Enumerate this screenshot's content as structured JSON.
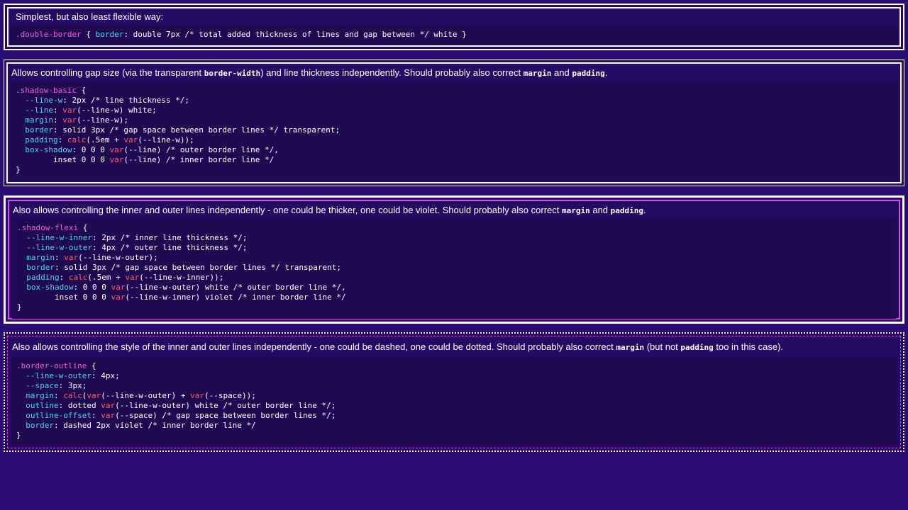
{
  "cards": [
    {
      "description": "Simplest, but also least flexible way:",
      "code": [
        [
          [
            "sel",
            ".double-border"
          ],
          [
            "punc",
            " { "
          ],
          [
            "prop",
            "border"
          ],
          [
            "punc",
            ": double 7px /* total added thickness of lines and gap between */ white }"
          ]
        ]
      ]
    },
    {
      "description_parts": [
        [
          "text",
          "Allows controlling gap size (via the transparent "
        ],
        [
          "code",
          "border-width"
        ],
        [
          "text",
          ") and line thickness independently. Should probably also correct "
        ],
        [
          "code",
          "margin"
        ],
        [
          "text",
          " and "
        ],
        [
          "code",
          "padding"
        ],
        [
          "text",
          "."
        ]
      ],
      "code": [
        [
          [
            "sel",
            ".shadow-basic"
          ],
          [
            "punc",
            " {"
          ]
        ],
        [
          [
            "punc",
            "  "
          ],
          [
            "prop",
            "--line-w"
          ],
          [
            "punc",
            ": 2px /* line thickness */;"
          ]
        ],
        [
          [
            "punc",
            "  "
          ],
          [
            "prop",
            "--line"
          ],
          [
            "punc",
            ": "
          ],
          [
            "fn",
            "var"
          ],
          [
            "punc",
            "(--line-w) white;"
          ]
        ],
        [
          [
            "punc",
            "  "
          ],
          [
            "prop",
            "margin"
          ],
          [
            "punc",
            ": "
          ],
          [
            "fn",
            "var"
          ],
          [
            "punc",
            "(--line-w);"
          ]
        ],
        [
          [
            "punc",
            "  "
          ],
          [
            "prop",
            "border"
          ],
          [
            "punc",
            ": solid 3px /* gap space between border lines */ transparent;"
          ]
        ],
        [
          [
            "punc",
            "  "
          ],
          [
            "prop",
            "padding"
          ],
          [
            "punc",
            ": "
          ],
          [
            "fn",
            "calc"
          ],
          [
            "punc",
            "(.5em + "
          ],
          [
            "fn",
            "var"
          ],
          [
            "punc",
            "(--line-w));"
          ]
        ],
        [
          [
            "punc",
            "  "
          ],
          [
            "prop",
            "box-shadow"
          ],
          [
            "punc",
            ": 0 0 0 "
          ],
          [
            "fn",
            "var"
          ],
          [
            "punc",
            "(--line) /* outer border line */,"
          ]
        ],
        [
          [
            "punc",
            "        inset 0 0 0 "
          ],
          [
            "fn",
            "var"
          ],
          [
            "punc",
            "(--line) /* inner border line */"
          ]
        ],
        [
          [
            "punc",
            "}"
          ]
        ]
      ]
    },
    {
      "description_parts": [
        [
          "text",
          "Also allows controlling the inner and outer lines independently - one could be thicker, one could be violet. Should probably also correct "
        ],
        [
          "code",
          "margin"
        ],
        [
          "text",
          " and "
        ],
        [
          "code",
          "padding"
        ],
        [
          "text",
          "."
        ]
      ],
      "code": [
        [
          [
            "sel",
            ".shadow-flexi"
          ],
          [
            "punc",
            " {"
          ]
        ],
        [
          [
            "punc",
            "  "
          ],
          [
            "prop",
            "--line-w-inner"
          ],
          [
            "punc",
            ": 2px /* inner line thickness */;"
          ]
        ],
        [
          [
            "punc",
            "  "
          ],
          [
            "prop",
            "--line-w-outer"
          ],
          [
            "punc",
            ": 4px /* outer line thickness */;"
          ]
        ],
        [
          [
            "punc",
            "  "
          ],
          [
            "prop",
            "margin"
          ],
          [
            "punc",
            ": "
          ],
          [
            "fn",
            "var"
          ],
          [
            "punc",
            "(--line-w-outer);"
          ]
        ],
        [
          [
            "punc",
            "  "
          ],
          [
            "prop",
            "border"
          ],
          [
            "punc",
            ": solid 3px /* gap space between border lines */ transparent;"
          ]
        ],
        [
          [
            "punc",
            "  "
          ],
          [
            "prop",
            "padding"
          ],
          [
            "punc",
            ": "
          ],
          [
            "fn",
            "calc"
          ],
          [
            "punc",
            "(.5em + "
          ],
          [
            "fn",
            "var"
          ],
          [
            "punc",
            "(--line-w-inner));"
          ]
        ],
        [
          [
            "punc",
            "  "
          ],
          [
            "prop",
            "box-shadow"
          ],
          [
            "punc",
            ": 0 0 0 "
          ],
          [
            "fn",
            "var"
          ],
          [
            "punc",
            "(--line-w-outer) white /* outer border line */,"
          ]
        ],
        [
          [
            "punc",
            "        inset 0 0 0 "
          ],
          [
            "fn",
            "var"
          ],
          [
            "punc",
            "(--line-w-inner) violet /* inner border line */"
          ]
        ],
        [
          [
            "punc",
            "}"
          ]
        ]
      ]
    },
    {
      "description_parts": [
        [
          "text",
          "Also allows controlling the style of the inner and outer lines independently - one could be dashed, one could be dotted. Should probably also correct "
        ],
        [
          "code",
          "margin"
        ],
        [
          "text",
          " (but not "
        ],
        [
          "code",
          "padding"
        ],
        [
          "text",
          " too in this case)."
        ]
      ],
      "code": [
        [
          [
            "sel",
            ".border-outline"
          ],
          [
            "punc",
            " {"
          ]
        ],
        [
          [
            "punc",
            "  "
          ],
          [
            "prop",
            "--line-w-outer"
          ],
          [
            "punc",
            ": 4px;"
          ]
        ],
        [
          [
            "punc",
            "  "
          ],
          [
            "prop",
            "--space"
          ],
          [
            "punc",
            ": 3px;"
          ]
        ],
        [
          [
            "punc",
            "  "
          ],
          [
            "prop",
            "margin"
          ],
          [
            "punc",
            ": "
          ],
          [
            "fn",
            "calc"
          ],
          [
            "punc",
            "("
          ],
          [
            "fn",
            "var"
          ],
          [
            "punc",
            "(--line-w-outer) + "
          ],
          [
            "fn",
            "var"
          ],
          [
            "punc",
            "(--space));"
          ]
        ],
        [
          [
            "punc",
            "  "
          ],
          [
            "prop",
            "outline"
          ],
          [
            "punc",
            ": dotted "
          ],
          [
            "fn",
            "var"
          ],
          [
            "punc",
            "(--line-w-outer) white /* outer border line */;"
          ]
        ],
        [
          [
            "punc",
            "  "
          ],
          [
            "prop",
            "outline-offset"
          ],
          [
            "punc",
            ": "
          ],
          [
            "fn",
            "var"
          ],
          [
            "punc",
            "(--space) /* gap space between border lines */;"
          ]
        ],
        [
          [
            "punc",
            "  "
          ],
          [
            "prop",
            "border"
          ],
          [
            "punc",
            ": dashed 2px violet /* inner border line */"
          ]
        ],
        [
          [
            "punc",
            "}"
          ]
        ]
      ]
    }
  ],
  "colors": {
    "page_bg": "#2a0a73",
    "selector": "#f45dd7",
    "property": "#4dd7ee",
    "function": "#ff5a6e",
    "violet_line": "#d84fe0"
  }
}
